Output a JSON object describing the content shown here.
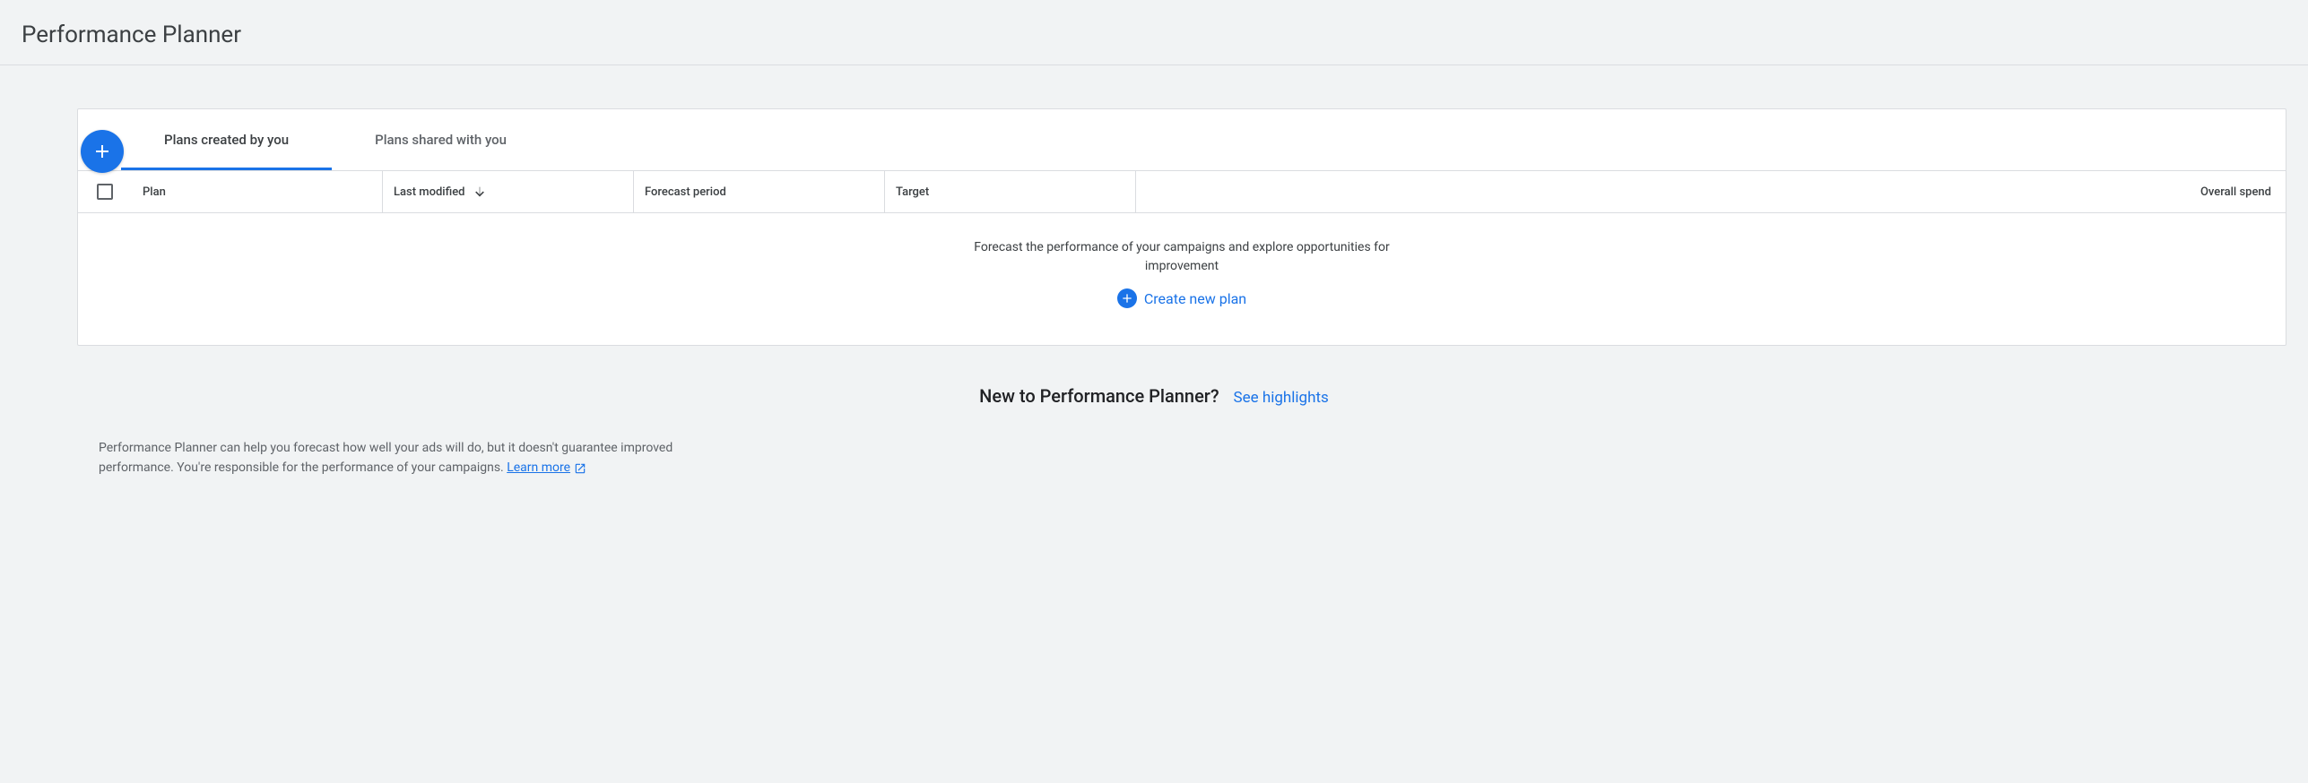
{
  "header": {
    "title": "Performance Planner"
  },
  "tabs": {
    "created": "Plans created by you",
    "shared": "Plans shared with you"
  },
  "table": {
    "columns": {
      "plan": "Plan",
      "modified": "Last modified",
      "forecast": "Forecast period",
      "target": "Target",
      "spend": "Overall spend"
    }
  },
  "empty": {
    "message": "Forecast the performance of your campaigns and explore opportunities for improvement",
    "cta": "Create new plan"
  },
  "highlights": {
    "heading": "New to Performance Planner?",
    "link": "See highlights"
  },
  "disclaimer": {
    "text": "Performance Planner can help you forecast how well your ads will do, but it doesn't guarantee improved performance. You're responsible for the performance of your campaigns. ",
    "learn_more": "Learn more"
  }
}
